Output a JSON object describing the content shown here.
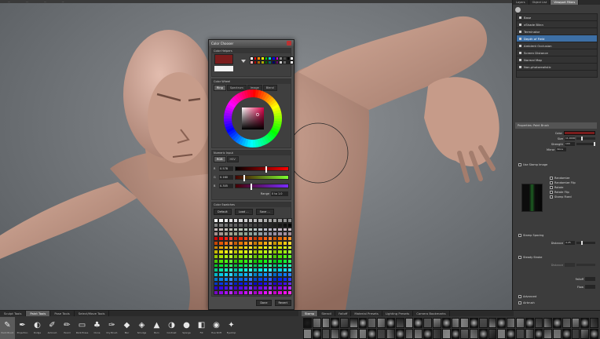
{
  "viewport": {
    "menu_items": [
      "...",
      "...",
      "...",
      "..."
    ]
  },
  "color_chooser": {
    "title": "Color Chooser",
    "helpers_label": "Color Helpers",
    "wheel_label": "Color Wheel",
    "wheel_tabs": [
      "Ring",
      "Spectrum",
      "Image",
      "Blend"
    ],
    "numeric_label": "Numeric Input",
    "numeric_tabs": [
      "RGB",
      "HSV"
    ],
    "channels": [
      {
        "label": "R",
        "value": "0.578",
        "fraction": 0.58
      },
      {
        "label": "G",
        "value": "0.160",
        "fraction": 0.16
      },
      {
        "label": "B",
        "value": "0.305",
        "fraction": 0.3
      }
    ],
    "range_label": "Range",
    "range_value": "0 to 1.0",
    "swatches_label": "Color Swatches",
    "swatch_preset": "Default",
    "load_button": "Load ...",
    "save_button": "Save ...",
    "done_button": "Done",
    "revert_button": "Revert",
    "current_color": "#7a1c1c"
  },
  "right_panel": {
    "tabs": [
      "Layers",
      "Object List",
      "Viewport Filters"
    ],
    "layers": [
      {
        "name": "Base",
        "selected": false
      },
      {
        "name": "xShade Blinn",
        "selected": false
      },
      {
        "name": "Terminator",
        "selected": false
      },
      {
        "name": "Depth of Field",
        "selected": true
      },
      {
        "name": "Ambient Occlusion",
        "selected": false
      },
      {
        "name": "Screen Distance",
        "selected": false
      },
      {
        "name": "Normal Map",
        "selected": false
      },
      {
        "name": "Non-photorealistic",
        "selected": false
      }
    ],
    "properties_header": "Properties: Paint Brush",
    "color_label": "Color",
    "color_value": "#7a1c1c",
    "props": [
      {
        "label": "Size",
        "value": "11.0000",
        "fraction": 0.3
      },
      {
        "label": "Strength",
        "value": "100",
        "fraction": 0.95
      },
      {
        "label": "Mirror",
        "value": "None",
        "fraction": 0
      }
    ],
    "use_stamp": "Use Stamp Image",
    "stamp_options": [
      "Randomize",
      "Randomize Flip",
      "Rotate",
      "Rotate Flip",
      "Stamp Fixed"
    ],
    "stamp_spacing": "Stamp Spacing",
    "distance_label": "Distance",
    "distance_value": "4.25",
    "steady_stroke": "Steady Stroke",
    "steady_distance_label": "Distance",
    "falloff_label": "Falloff",
    "flow_label": "Flow",
    "advanced_label": "Advanced",
    "airbrush_label": "Airbrush"
  },
  "shelf": {
    "tabs": [
      {
        "label": "Sculpt Tools",
        "active": false
      },
      {
        "label": "Paint Tools",
        "active": true
      },
      {
        "label": "Pose Tools",
        "active": false
      },
      {
        "label": "Select/Move Tools",
        "active": false
      }
    ],
    "tools": [
      {
        "label": "Paint Brush",
        "glyph": "✎",
        "active": true
      },
      {
        "label": "Projection",
        "glyph": "✒",
        "active": false
      },
      {
        "label": "Dodge",
        "glyph": "◐",
        "active": false
      },
      {
        "label": "Airbrush",
        "glyph": "✐",
        "active": false
      },
      {
        "label": "Pencil",
        "glyph": "✏",
        "active": false
      },
      {
        "label": "Paint Erase",
        "glyph": "▭",
        "active": false
      },
      {
        "label": "Clone",
        "glyph": "♣",
        "active": false
      },
      {
        "label": "Dry Brush",
        "glyph": "✑",
        "active": false
      },
      {
        "label": "Blur",
        "glyph": "◆",
        "active": false
      },
      {
        "label": "Smudge",
        "glyph": "◈",
        "active": false
      },
      {
        "label": "Burn",
        "glyph": "▲",
        "active": false
      },
      {
        "label": "Contrast",
        "glyph": "◑",
        "active": false
      },
      {
        "label": "Sponge",
        "glyph": "●",
        "active": false
      },
      {
        "label": "Fill",
        "glyph": "◧",
        "active": false
      },
      {
        "label": "Hue Shift",
        "glyph": "◉",
        "active": false
      },
      {
        "label": "Eyedrop",
        "glyph": "✦",
        "active": false
      }
    ],
    "stamp_tabs": [
      {
        "label": "Stamp",
        "active": true
      },
      {
        "label": "Stencil",
        "active": false
      },
      {
        "label": "Falloff",
        "active": false
      },
      {
        "label": "Material Presets",
        "active": false
      },
      {
        "label": "Lighting Presets",
        "active": false
      },
      {
        "label": "Camera Bookmarks",
        "active": false
      }
    ]
  }
}
